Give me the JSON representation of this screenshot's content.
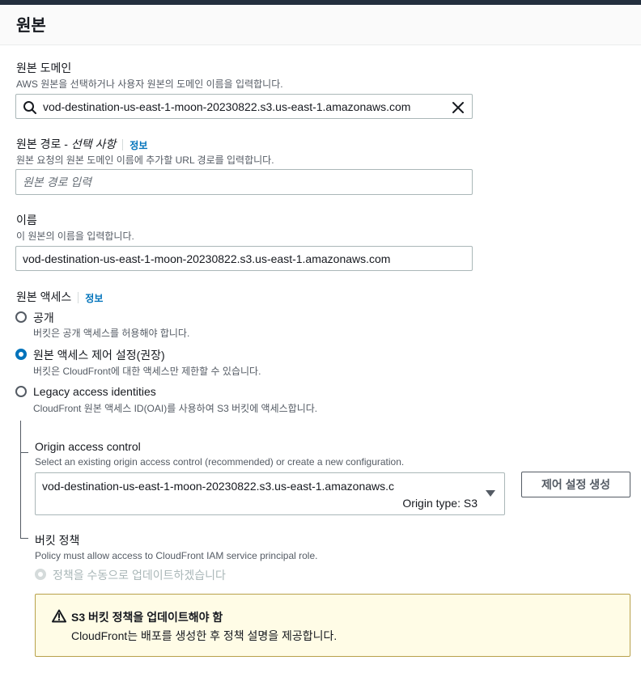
{
  "section": {
    "title": "원본"
  },
  "origin_domain": {
    "label": "원본 도메인",
    "description": "AWS 원본을 선택하거나 사용자 원본의 도메인 이름을 입력합니다.",
    "value": "vod-destination-us-east-1-moon-20230822.s3.us-east-1.amazonaws.com"
  },
  "origin_path": {
    "label": "원본 경로 - ",
    "label_optional": "선택 사항",
    "info": "정보",
    "description": "원본 요청의 원본 도메인 이름에 추가할 URL 경로를 입력합니다.",
    "placeholder": "원본 경로 입력"
  },
  "name": {
    "label": "이름",
    "description": "이 원본의 이름을 입력합니다.",
    "value": "vod-destination-us-east-1-moon-20230822.s3.us-east-1.amazonaws.com"
  },
  "origin_access": {
    "label": "원본 액세스",
    "info": "정보",
    "options": [
      {
        "label": "공개",
        "description": "버킷은 공개 액세스를 허용해야 합니다.",
        "selected": false
      },
      {
        "label": "원본 액세스 제어 설정(권장)",
        "description": "버킷은 CloudFront에 대한 액세스만 제한할 수 있습니다.",
        "selected": true
      },
      {
        "label": "Legacy access identities",
        "description": "CloudFront 원본 액세스 ID(OAI)를 사용하여 S3 버킷에 액세스합니다.",
        "selected": false
      }
    ]
  },
  "origin_access_control": {
    "label": "Origin access control",
    "description": "Select an existing origin access control (recommended) or create a new configuration.",
    "selected_value": "vod-destination-us-east-1-moon-20230822.s3.us-east-1.amazonaws.c",
    "selected_sub": "Origin type: S3",
    "create_button": "제어 설정 생성"
  },
  "bucket_policy": {
    "label": "버킷 정책",
    "description": "Policy must allow access to CloudFront IAM service principal role.",
    "option_label": "정책을 수동으로 업데이트하겠습니다"
  },
  "alert": {
    "title": "S3 버킷 정책을 업데이트해야 함",
    "body": "CloudFront는 배포를 생성한 후 정책 설명을 제공합니다."
  },
  "colors": {
    "accent": "#0073bb",
    "warning_border": "#b8a14a",
    "warning_bg": "#fffce6"
  }
}
